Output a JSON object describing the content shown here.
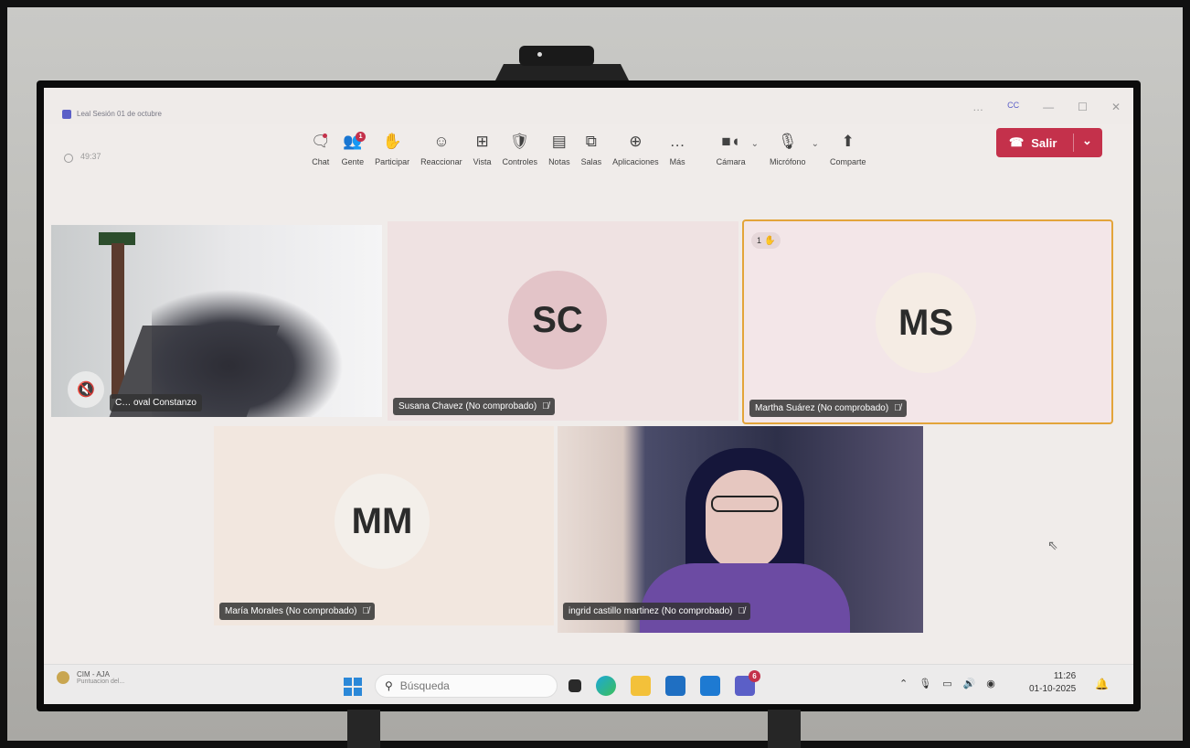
{
  "window": {
    "title": "Leal Sesión 01 de octubre",
    "timer": "49:37",
    "controls": [
      "…",
      "CC",
      "—",
      "☐",
      "✕"
    ]
  },
  "toolbar": {
    "items": [
      {
        "label": "Chat",
        "icon": "chat-icon",
        "glyph": "🗨"
      },
      {
        "label": "Gente",
        "icon": "people-icon",
        "glyph": "👥",
        "badge": "1"
      },
      {
        "label": "Participar",
        "icon": "raise-hand-icon",
        "glyph": "✋"
      },
      {
        "label": "Reaccionar",
        "icon": "smiley-icon",
        "glyph": "☺"
      },
      {
        "label": "Vista",
        "icon": "grid-view-icon",
        "glyph": "⊞"
      },
      {
        "label": "Controles",
        "icon": "shield-icon",
        "glyph": "🛡"
      },
      {
        "label": "Notas",
        "icon": "notes-icon",
        "glyph": "▤"
      },
      {
        "label": "Salas",
        "icon": "rooms-icon",
        "glyph": "⧉"
      },
      {
        "label": "Aplicaciones",
        "icon": "add-apps-icon",
        "glyph": "⊕"
      },
      {
        "label": "Más",
        "icon": "more-icon",
        "glyph": "…"
      }
    ],
    "camera_label": "Cámara",
    "mic_label": "Micrófono",
    "share_label": "Comparte",
    "leave_label": "Salir"
  },
  "participants": [
    {
      "id": "room",
      "name": "C… oval Constanzo",
      "type": "video"
    },
    {
      "id": "sc",
      "name": "Susana Chavez (No comprobado)",
      "initials": "SC",
      "avatar_color": "#e3c4c8"
    },
    {
      "id": "ms",
      "name": "Martha Suárez (No comprobado)",
      "initials": "MS",
      "avatar_color": "#f5ece4",
      "hand_raised": "1",
      "speaking_border": "#e3a43a"
    },
    {
      "id": "mm",
      "name": "María Morales (No comprobado)",
      "initials": "MM",
      "avatar_color": "#f3efea"
    },
    {
      "id": "ingrid",
      "name": "ingrid castillo martinez (No comprobado)",
      "type": "video"
    }
  ],
  "taskbar": {
    "widget_title": "CIM - AJA",
    "widget_sub": "Puntuacion del...",
    "search_placeholder": "Búsqueda",
    "teams_badge": "6",
    "time": "11:26",
    "date": "01-10-2025"
  }
}
